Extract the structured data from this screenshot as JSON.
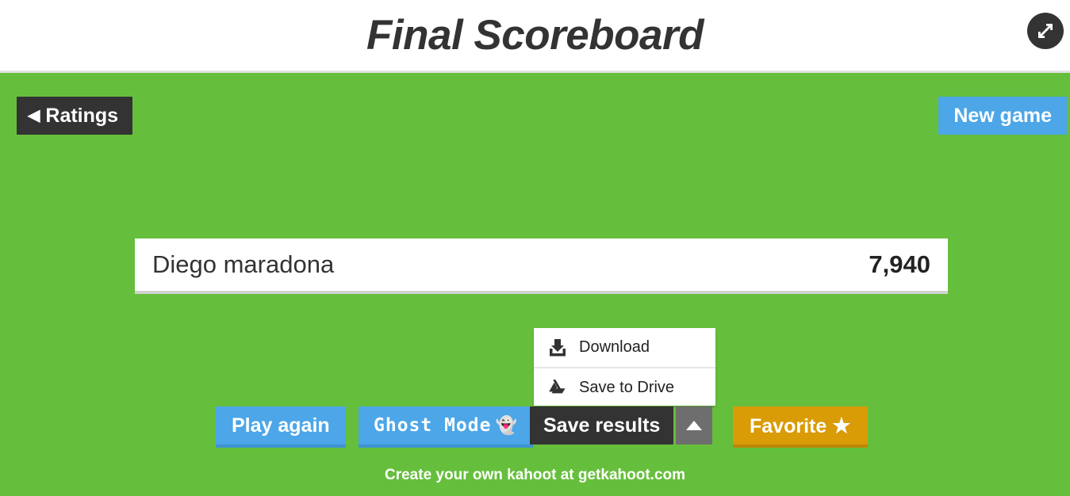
{
  "header": {
    "title": "Final Scoreboard",
    "fullscreen_icon": "fullscreen-expand-icon"
  },
  "stage": {
    "background_color": "#66bf3c",
    "ratings_button": {
      "caret": "◀",
      "label": "Ratings"
    },
    "new_game_button": {
      "label": "New game",
      "color": "#4ca6e8"
    }
  },
  "scoreboard": {
    "rows": [
      {
        "name": "Diego maradona",
        "score": "7,940"
      }
    ]
  },
  "dropdown": {
    "open": true,
    "items": [
      {
        "label": "Download",
        "icon": "download-icon"
      },
      {
        "label": "Save to Drive",
        "icon": "google-drive-icon"
      }
    ]
  },
  "buttons": {
    "play_again": {
      "label": "Play again",
      "color": "#4ca6e8"
    },
    "ghost_mode": {
      "label": "Ghost Mode",
      "emoji": "👻",
      "color": "#4ca6e8"
    },
    "save_results": {
      "label": "Save results",
      "color": "#333333"
    },
    "save_toggle": {
      "icon": "caret-up-icon",
      "color": "#6e6e6e"
    },
    "favorite": {
      "label": "Favorite",
      "star": "★",
      "color": "#d99b06"
    }
  },
  "footer": {
    "text": "Create your own kahoot at ",
    "domain": "getkahoot.com"
  }
}
